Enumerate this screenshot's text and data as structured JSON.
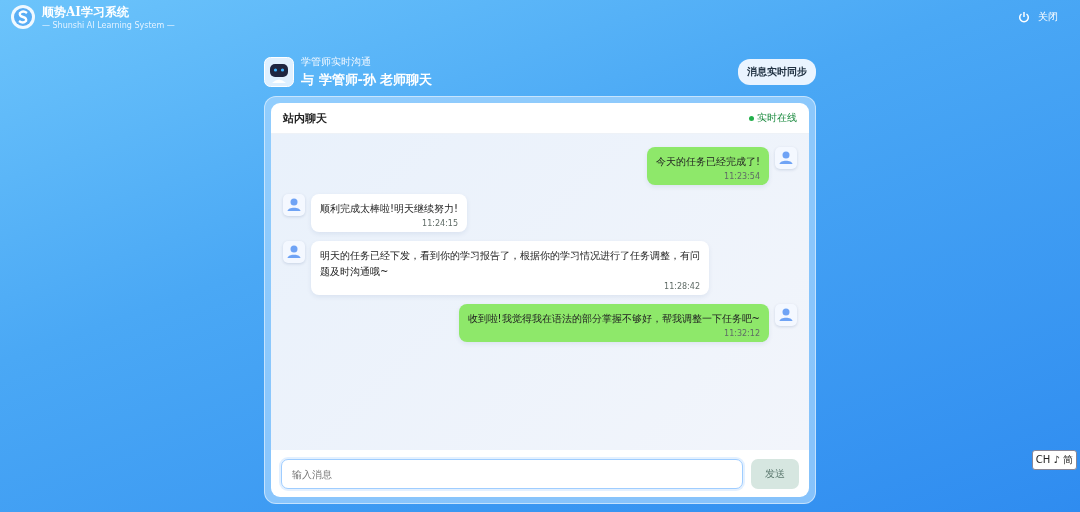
{
  "app": {
    "name": "顺势AI学习系统",
    "subtitle": "— Shunshi AI Learning System —",
    "close_label": "关闭"
  },
  "header": {
    "eyebrow": "学管师实时沟通",
    "title": "与 学管师-孙 老师聊天",
    "sync_button": "消息实时同步"
  },
  "chat": {
    "title": "站内聊天",
    "status": {
      "label": "实时在线",
      "color": "#22b04b"
    },
    "messages": [
      {
        "kind": "sent",
        "text": "今天的任务已经完成了!",
        "time": "11:23:54"
      },
      {
        "kind": "received",
        "text": "顺利完成太棒啦!明天继续努力!",
        "time": "11:24:15"
      },
      {
        "kind": "received",
        "text": "明天的任务已经下发，看到你的学习报告了，根据你的学习情况进行了任务调整，有问题及时沟通哦~",
        "time": "11:28:42"
      },
      {
        "kind": "sent",
        "text": "收到啦!我觉得我在语法的部分掌握不够好，帮我调整一下任务吧~",
        "time": "11:32:12"
      }
    ],
    "input": {
      "placeholder": "输入消息"
    },
    "send_button": {
      "label": "发送",
      "disabled": true
    }
  },
  "ime_indicator": "CH ♪ 简"
}
